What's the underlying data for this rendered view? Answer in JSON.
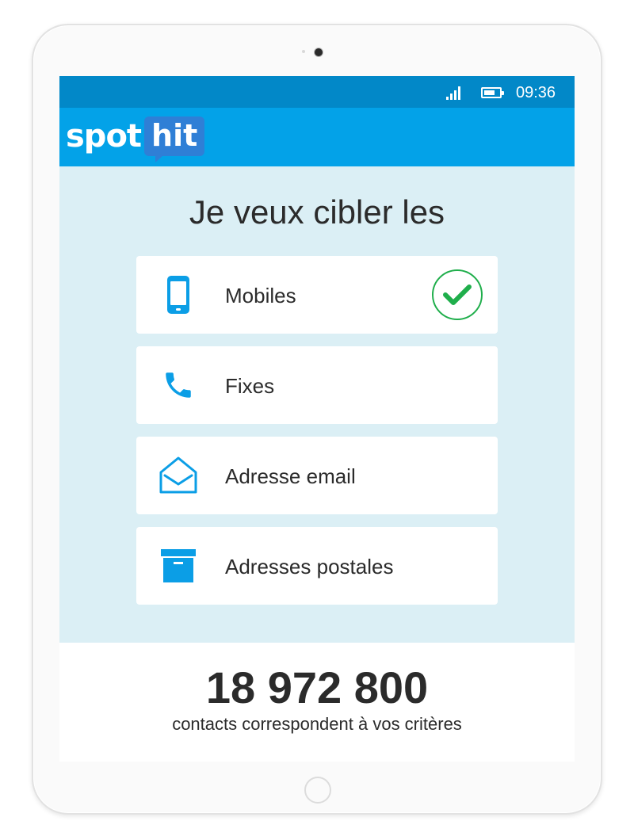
{
  "status_bar": {
    "time": "09:36",
    "battery_level": 0.7,
    "signal_icon": "signal-icon",
    "battery_icon": "battery-icon"
  },
  "app": {
    "logo_part1": "spot",
    "logo_part2": "hit"
  },
  "heading": "Je veux cibler les",
  "options": [
    {
      "label": "Mobiles",
      "icon": "mobile-phone-icon",
      "selected": true
    },
    {
      "label": "Fixes",
      "icon": "phone-handset-icon",
      "selected": false
    },
    {
      "label": "Adresse email",
      "icon": "envelope-open-icon",
      "selected": false
    },
    {
      "label": "Adresses postales",
      "icon": "box-icon",
      "selected": false
    }
  ],
  "result": {
    "count": "18 972 800",
    "caption": "contacts correspondent à vos critères"
  },
  "colors": {
    "accent": "#03a2e8",
    "status_bar": "#0288c8",
    "logo_badge": "#2f7fd6",
    "check": "#1fae4b",
    "background": "#dbeff5",
    "icon": "#0b9ee6"
  }
}
